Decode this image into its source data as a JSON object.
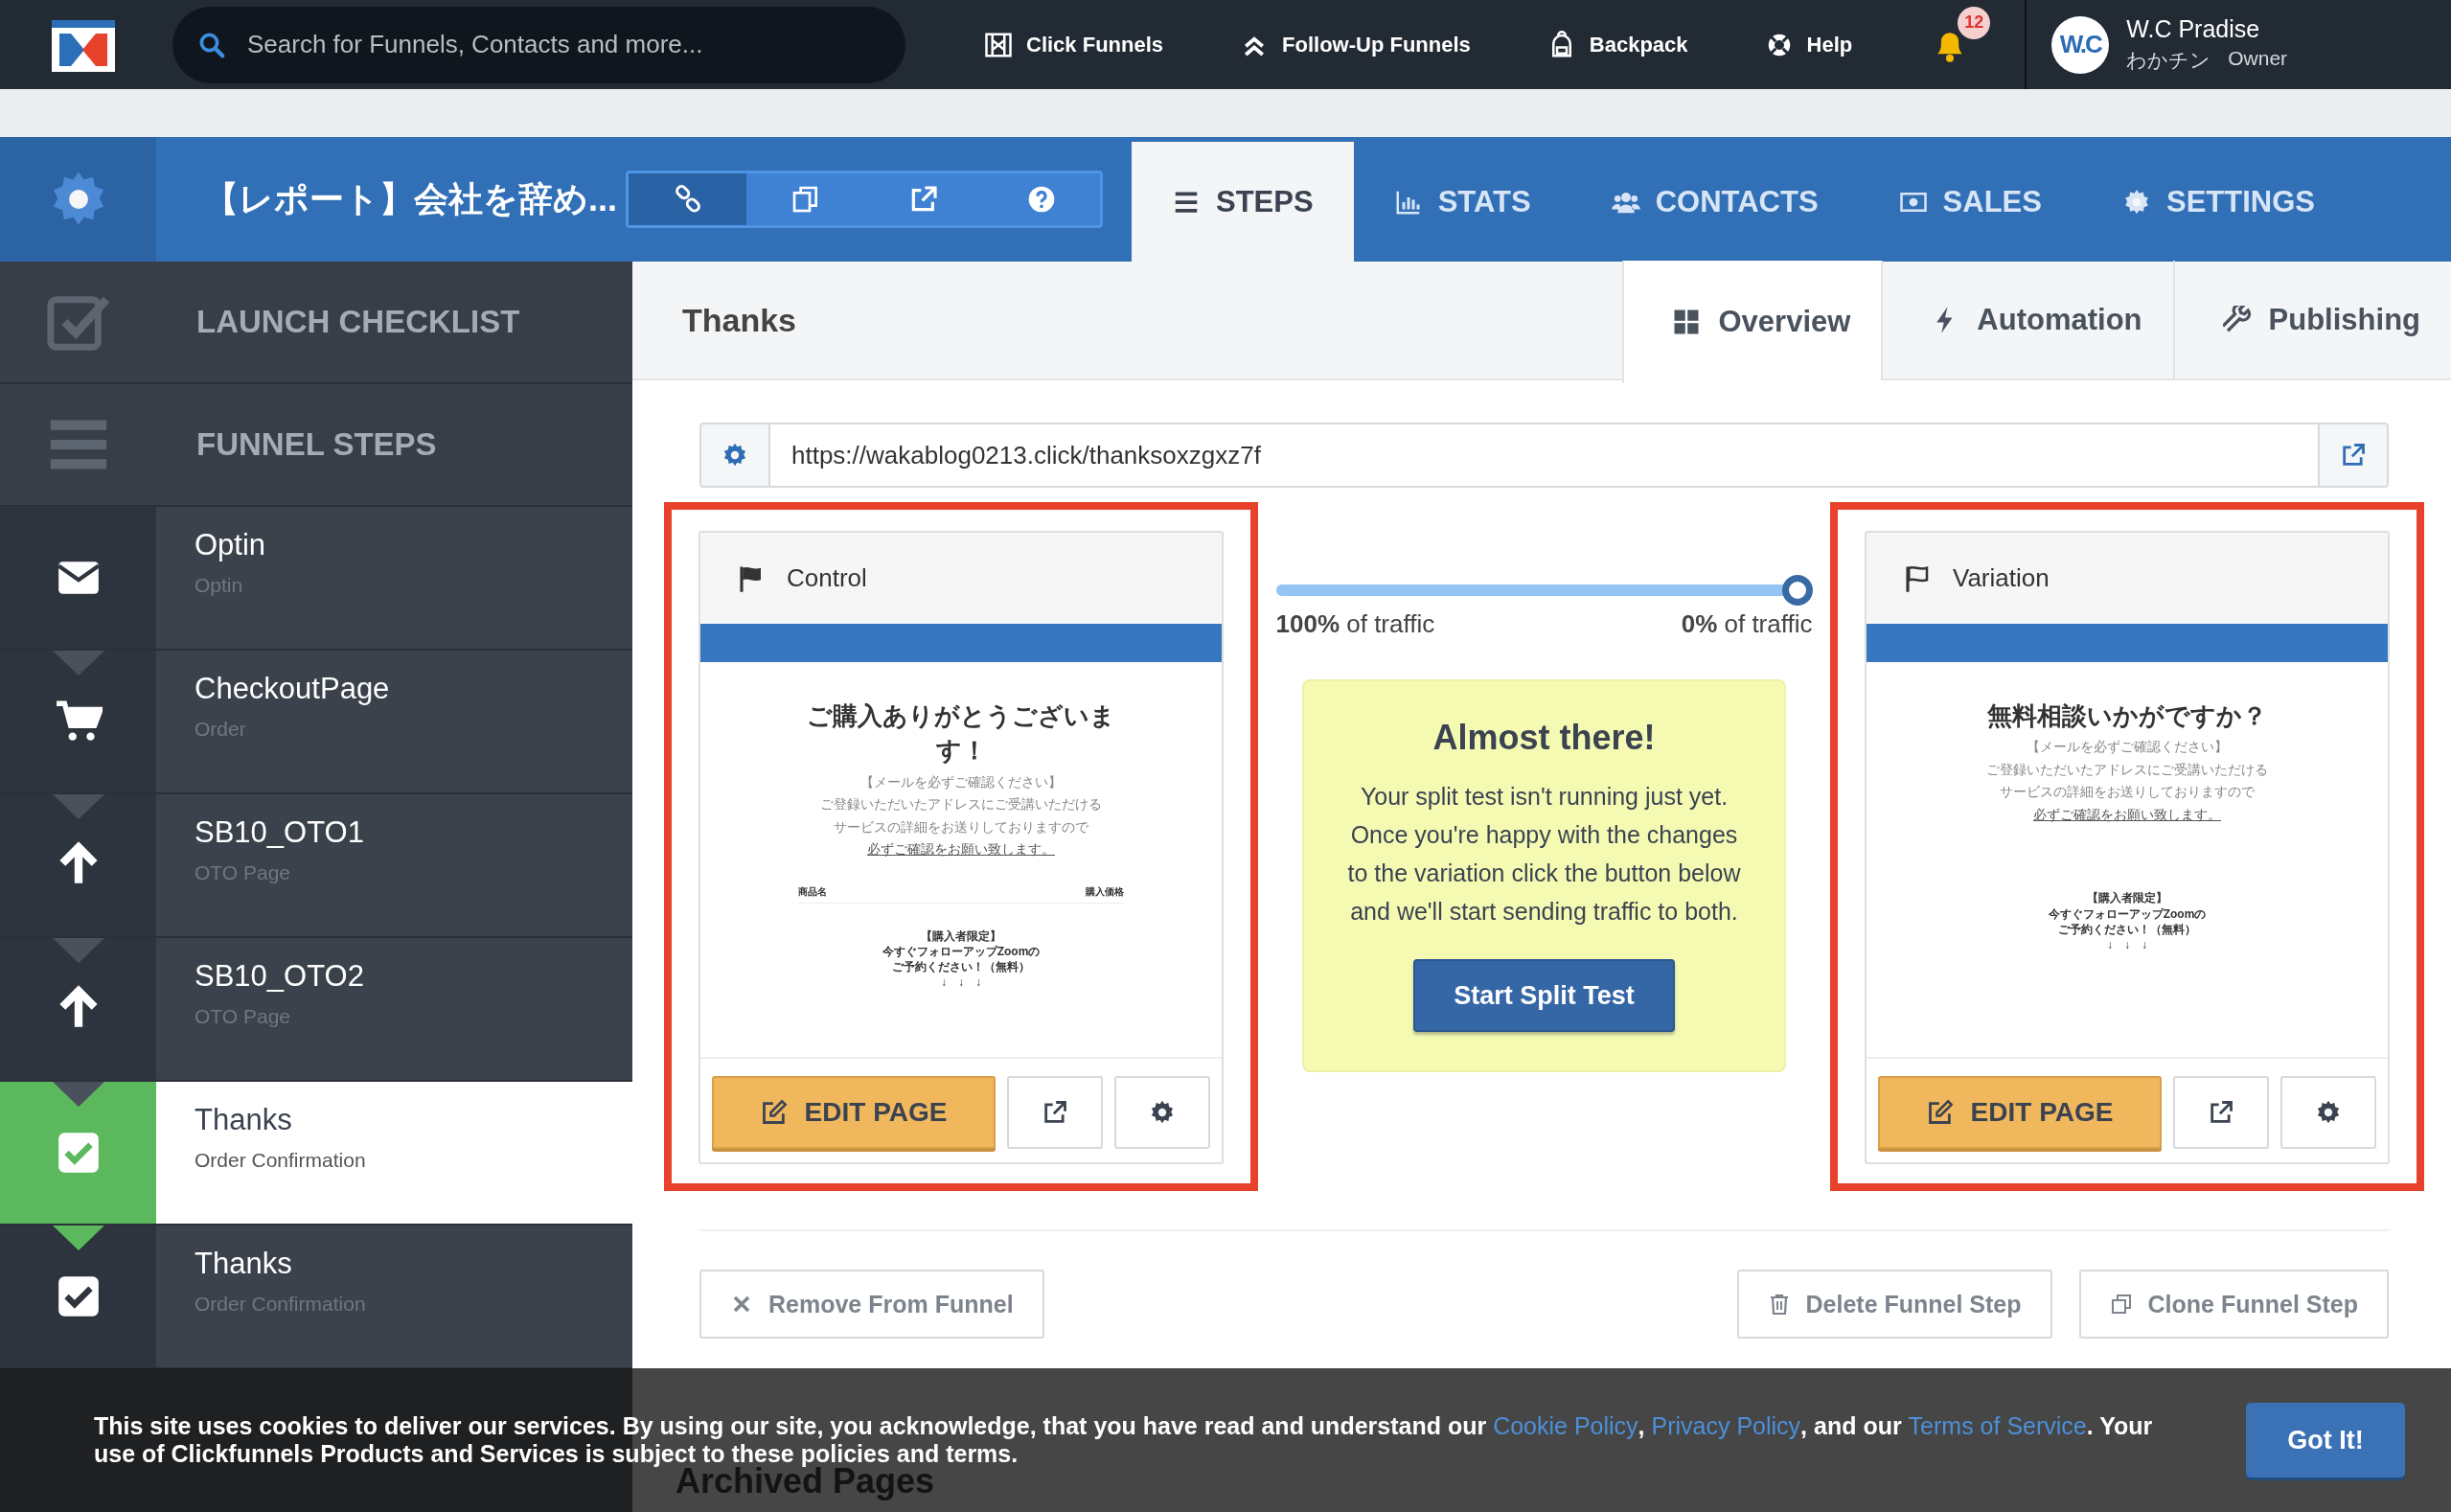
{
  "top_bar": {
    "search": {
      "placeholder": "Search for Funnels, Contacts and more..."
    },
    "nav": [
      {
        "kind": "filmstrip",
        "label": "Click Funnels"
      },
      {
        "kind": "chevrons",
        "label": "Follow-Up Funnels"
      },
      {
        "kind": "backpack",
        "label": "Backpack"
      },
      {
        "kind": "lifebuoy",
        "label": "Help"
      }
    ],
    "notifications": {
      "count": "12"
    },
    "user": {
      "initials": "W.C",
      "name": "W.C Pradise",
      "subtitle": "わかチン",
      "role": "Owner"
    }
  },
  "funnel_header": {
    "title": "【レポート】会社を辞め...",
    "tools": [
      {
        "kind": "link",
        "selected": true
      },
      {
        "kind": "copy",
        "selected": false
      },
      {
        "kind": "external",
        "selected": false
      },
      {
        "kind": "question",
        "selected": false
      }
    ],
    "tabs": [
      {
        "kind": "list",
        "label": "STEPS",
        "selected": true
      },
      {
        "kind": "chart",
        "label": "STATS",
        "selected": false
      },
      {
        "kind": "users",
        "label": "CONTACTS",
        "selected": false
      },
      {
        "kind": "money",
        "label": "SALES",
        "selected": false
      },
      {
        "kind": "gear",
        "label": "SETTINGS",
        "selected": false
      }
    ]
  },
  "sidebar": {
    "sections": [
      {
        "kind": "checkbox",
        "label": "LAUNCH CHECKLIST"
      },
      {
        "kind": "bars",
        "label": "FUNNEL STEPS"
      }
    ],
    "steps": [
      {
        "kind": "mail",
        "name": "Optin",
        "type": "Optin",
        "selected": false
      },
      {
        "kind": "cart",
        "name": "CheckoutPage",
        "type": "Order",
        "selected": false
      },
      {
        "kind": "up",
        "name": "SB10_OTO1",
        "type": "OTO Page",
        "selected": false
      },
      {
        "kind": "up",
        "name": "SB10_OTO2",
        "type": "OTO Page",
        "selected": false
      },
      {
        "kind": "check",
        "name": "Thanks",
        "type": "Order Confirmation",
        "selected": true
      },
      {
        "kind": "check",
        "name": "Thanks",
        "type": "Order Confirmation",
        "selected": false
      }
    ]
  },
  "page": {
    "title": "Thanks",
    "tabs": [
      {
        "kind": "grid",
        "label": "Overview",
        "selected": true
      },
      {
        "kind": "bolt",
        "label": "Automation",
        "selected": false
      },
      {
        "kind": "wrench",
        "label": "Publishing",
        "selected": false
      }
    ],
    "url": "https://wakablog0213.click/thanksoxzgxz7f",
    "variants": [
      {
        "kind": "control",
        "label": "Control",
        "highlighted": true,
        "edit_button": "EDIT PAGE",
        "preview": {
          "heading": "ご購入ありがとうございます！",
          "notice": [
            "【メールを必ずご確認ください】",
            "ご登録いただいたアドレスにご受講いただける",
            "サービスの詳細をお送りしておりますので",
            "必ずご確認をお願い致します。"
          ],
          "table_headers": [
            "商品名",
            "購入価格"
          ],
          "offer": [
            "【購入者限定】",
            "今すぐフォローアップZoomの",
            "ご予約ください！（無料）",
            "↓　↓　↓"
          ]
        }
      },
      {
        "kind": "variation",
        "label": "Variation",
        "highlighted": true,
        "edit_button": "EDIT PAGE",
        "preview": {
          "heading": "無料相談いかがですか？",
          "notice": [
            "【メールを必ずご確認ください】",
            "ご登録いただいたアドレスにご受講いただける",
            "サービスの詳細をお送りしておりますので",
            "必ずご確認をお願い致します。"
          ],
          "offer": [
            "【購入者限定】",
            "今すぐフォローアップZoomの",
            "ご予約ください！（無料）",
            "↓　↓　↓"
          ]
        }
      }
    ],
    "split": {
      "level": 1,
      "left_label": "**100%** of traffic",
      "right_label": "**0%** of traffic"
    },
    "notice": {
      "title": "Almost there!",
      "body": "Your split test isn't running just yet. Once you're happy with the changes to the variation click the button below and we'll start sending traffic to both.",
      "button": "Start Split Test"
    },
    "actions": [
      {
        "kind": "remove",
        "label": "Remove From Funnel"
      },
      {
        "kind": "delete",
        "label": "Delete Funnel Step"
      },
      {
        "kind": "clone",
        "label": "Clone Funnel Step"
      }
    ],
    "archived_title": "Archived Pages"
  },
  "cookie_banner": {
    "parts": [
      {
        "kind": "text",
        "text": "This site uses cookies to deliver our services. By using our site, you acknowledge, that you have read and understand our "
      },
      {
        "kind": "link",
        "text": "Cookie Policy"
      },
      {
        "kind": "text",
        "text": ", "
      },
      {
        "kind": "link",
        "text": "Privacy Policy"
      },
      {
        "kind": "text",
        "text": ", and our "
      },
      {
        "kind": "link",
        "text": "Terms of Service"
      },
      {
        "kind": "text",
        "text": ". Your use of Clickfunnels Products and Services is subject to these policies and terms."
      }
    ],
    "button": "Got It!"
  }
}
